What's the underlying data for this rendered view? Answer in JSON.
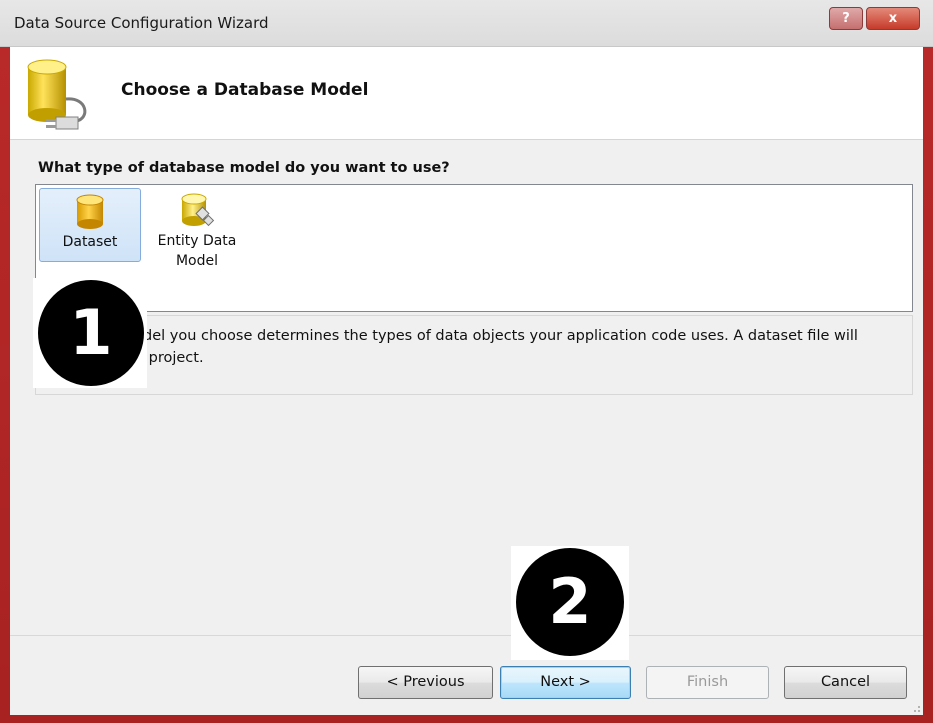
{
  "window": {
    "title": "Data Source Configuration Wizard",
    "help_label": "?",
    "close_label": "x"
  },
  "header": {
    "title": "Choose a Database Model"
  },
  "main": {
    "question": "What type of database model do you want to use?",
    "models": [
      {
        "label": "Dataset",
        "selected": true,
        "icon": "database-icon"
      },
      {
        "label_line1": "Entity Data",
        "label_line2": "Model",
        "selected": false,
        "icon": "entity-data-model-icon"
      }
    ],
    "description_line1": "model you choose determines the types of data objects your application code uses. A dataset file will",
    "description_line2": "our project."
  },
  "buttons": {
    "previous": "< Previous",
    "next": "Next >",
    "finish": "Finish",
    "cancel": "Cancel"
  },
  "callouts": {
    "one": "1",
    "two": "2"
  },
  "colors": {
    "frame": "#b92929",
    "selection": "#cfe3f8",
    "callout": "#000000"
  }
}
